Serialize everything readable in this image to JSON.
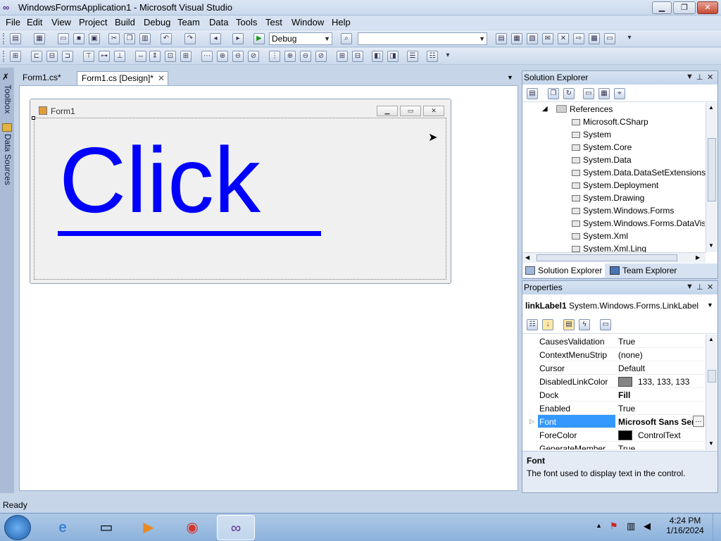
{
  "window": {
    "title": "WindowsFormsApplication1 - Microsoft Visual Studio",
    "controls": [
      "▁",
      "❐",
      "✕"
    ]
  },
  "menu": [
    "File",
    "Edit",
    "View",
    "Project",
    "Build",
    "Debug",
    "Team",
    "Data",
    "Tools",
    "Test",
    "Window",
    "Help"
  ],
  "toolbar": {
    "configuration": "Debug",
    "platform": ""
  },
  "left_tabs": [
    "Toolbox",
    "Data Sources"
  ],
  "doc_tabs": [
    {
      "label": "Form1.cs*"
    },
    {
      "label": "Form1.cs [Design]*"
    }
  ],
  "form": {
    "title": "Form1",
    "link_text": "Click",
    "colors": {
      "link": "#0000ff",
      "form_bg": "#f0f0f0"
    }
  },
  "solution_explorer": {
    "title": "Solution Explorer",
    "folder": "References",
    "items": [
      "Microsoft.CSharp",
      "System",
      "System.Core",
      "System.Data",
      "System.Data.DataSetExtensions",
      "System.Deployment",
      "System.Drawing",
      "System.Windows.Forms",
      "System.Windows.Forms.DataVis",
      "System.Xml",
      "System.Xml.Linq"
    ],
    "tabs": [
      "Solution Explorer",
      "Team Explorer"
    ]
  },
  "properties": {
    "title": "Properties",
    "object_name": "linkLabel1",
    "object_type": "System.Windows.Forms.LinkLabel",
    "rows": [
      {
        "name": "CausesValidation",
        "value": "True"
      },
      {
        "name": "ContextMenuStrip",
        "value": "(none)"
      },
      {
        "name": "Cursor",
        "value": "Default"
      },
      {
        "name": "DisabledLinkColor",
        "value": "133, 133, 133"
      },
      {
        "name": "Dock",
        "value": "Fill"
      },
      {
        "name": "Enabled",
        "value": "True"
      },
      {
        "name": "Font",
        "value": "Microsoft Sans Ser"
      },
      {
        "name": "ForeColor",
        "value": "ControlText"
      },
      {
        "name": "GenerateMember",
        "value": "True"
      }
    ],
    "swatches": {
      "disabled_link": "#858585",
      "fore": "#000000"
    },
    "desc_title": "Font",
    "desc_text": "The font used to display text in the control."
  },
  "status": "Ready",
  "clock": {
    "time": "4:24 PM",
    "date": "1/16/2024"
  }
}
